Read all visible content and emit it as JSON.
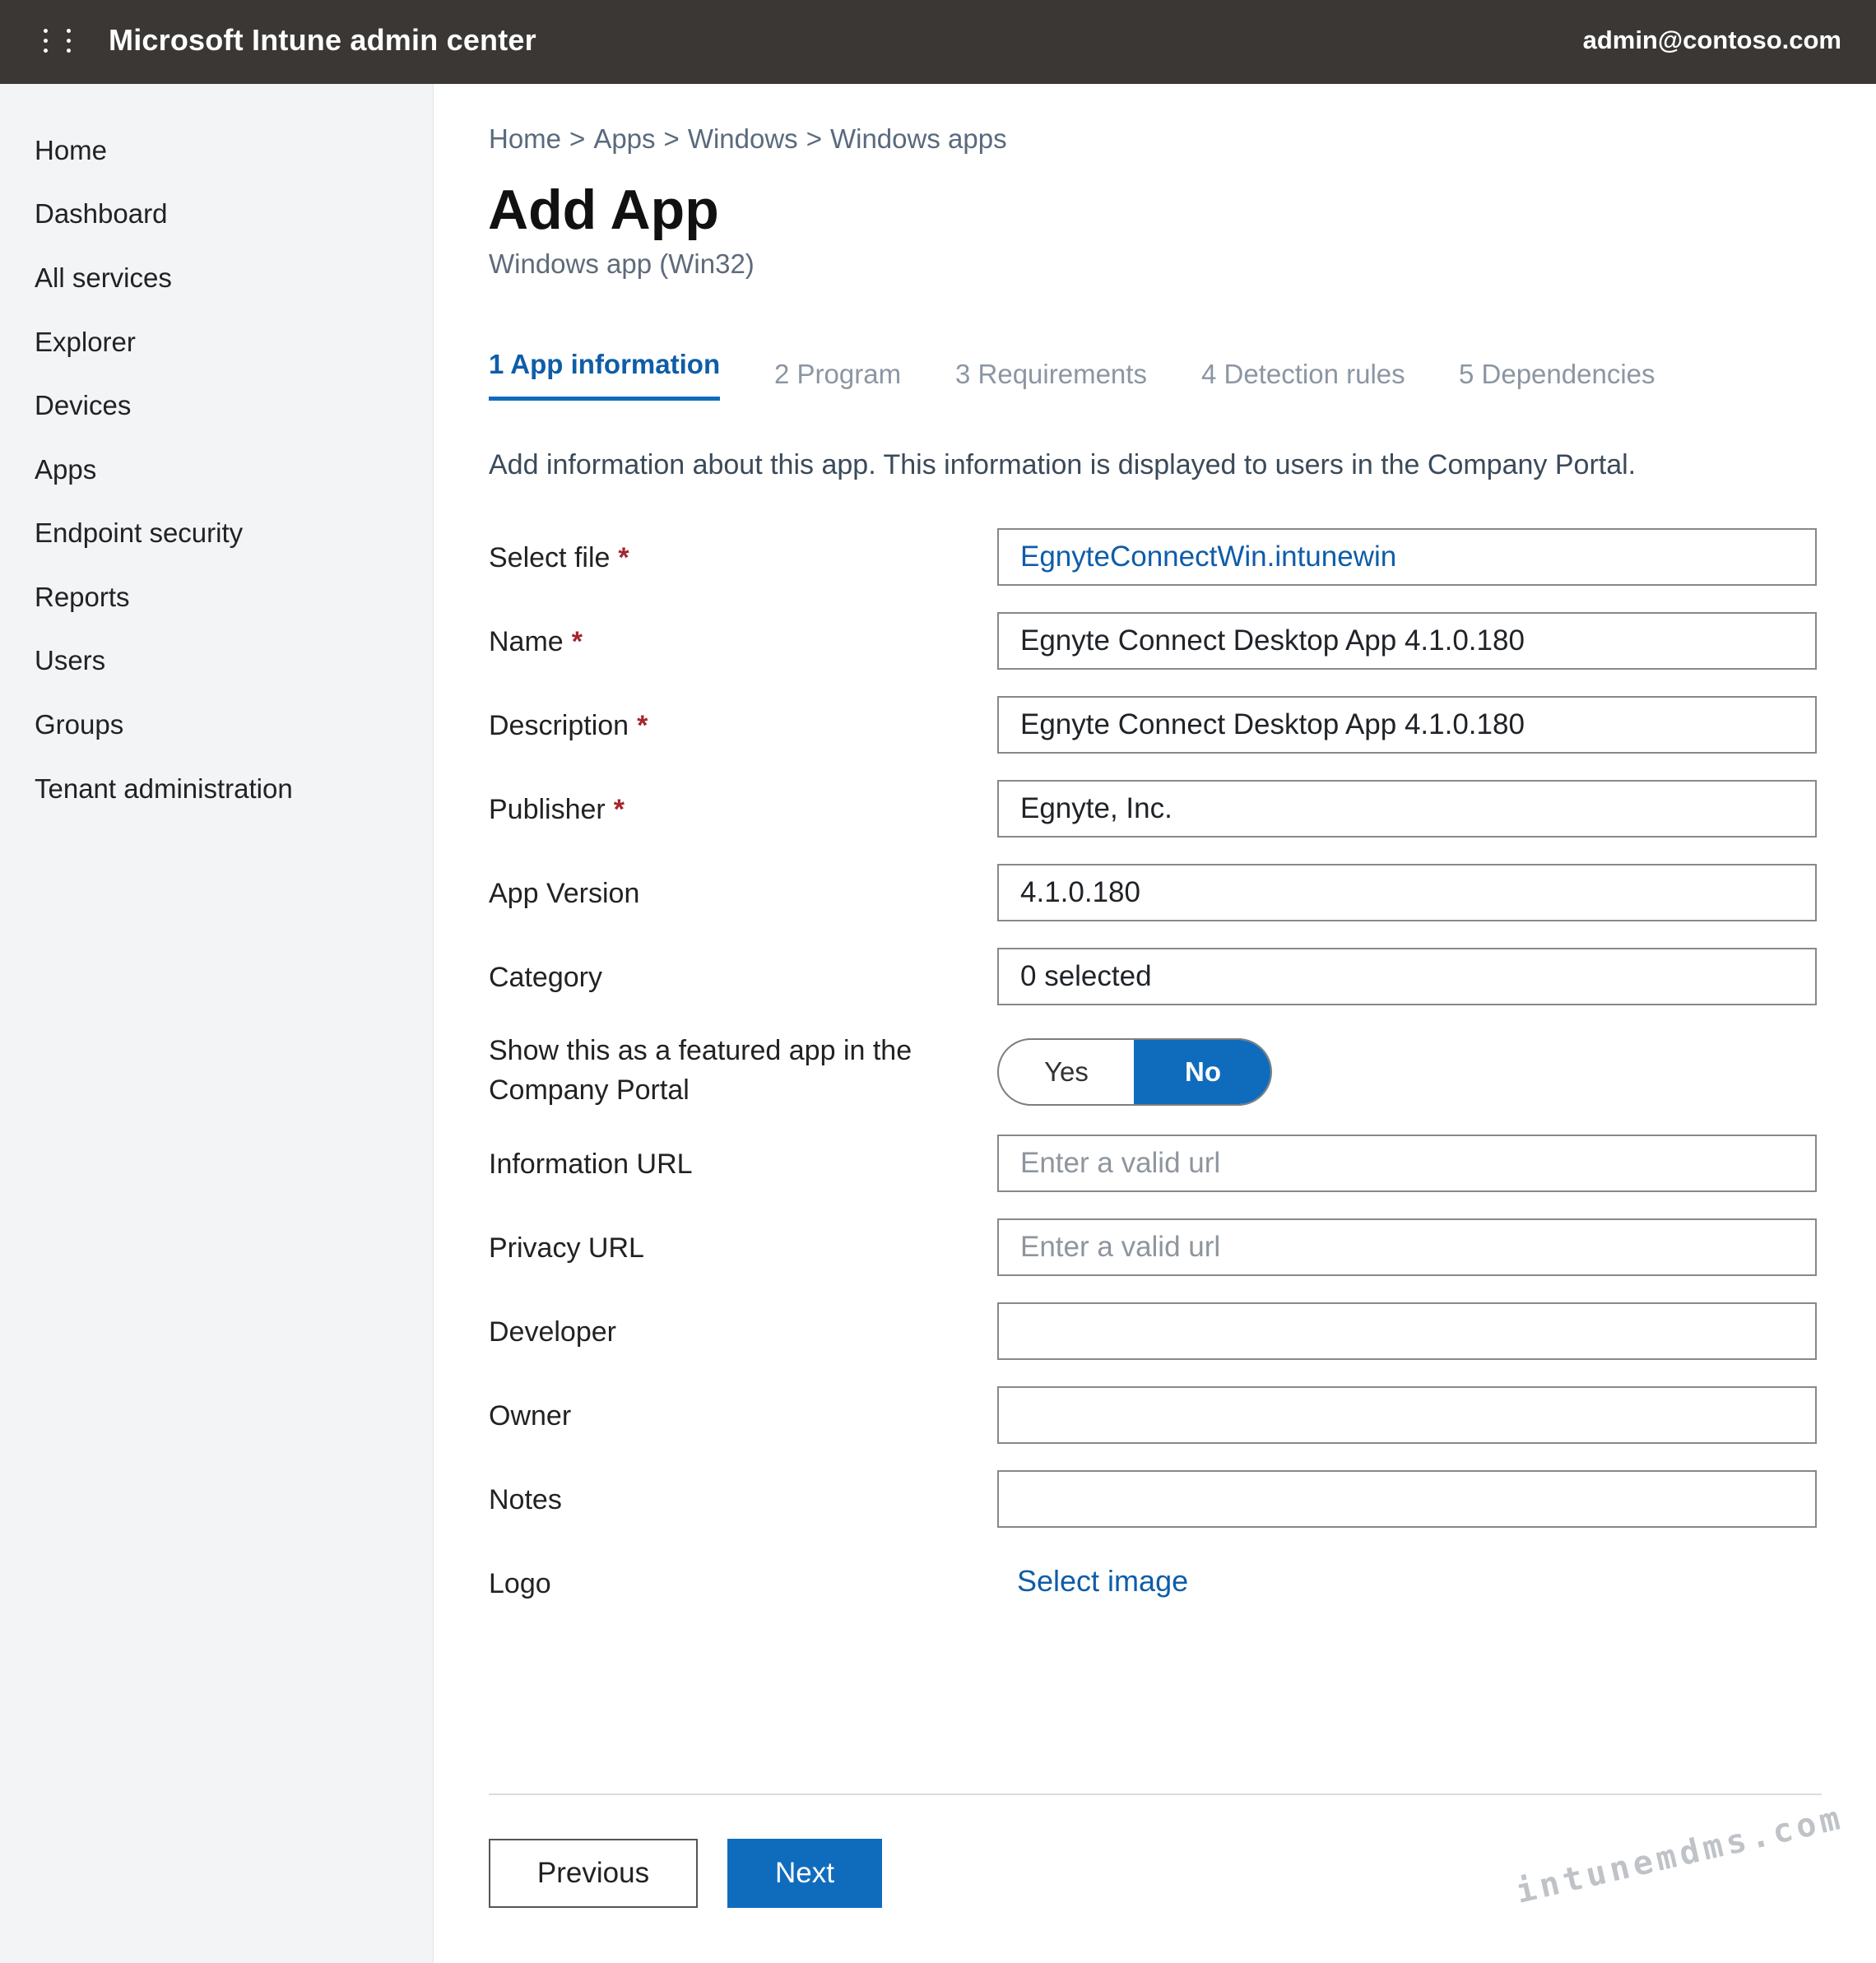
{
  "topbar": {
    "title": "Microsoft Intune admin center",
    "user": "admin@contoso.com",
    "menu_icon": "waffle-menu-icon"
  },
  "sidebar": {
    "items": [
      {
        "label": "Home"
      },
      {
        "label": "Dashboard"
      },
      {
        "label": "All services"
      },
      {
        "label": "Explorer"
      },
      {
        "label": "Devices"
      },
      {
        "label": "Apps"
      },
      {
        "label": "Endpoint security"
      },
      {
        "label": "Reports"
      },
      {
        "label": "Users"
      },
      {
        "label": "Groups"
      },
      {
        "label": "Tenant administration"
      }
    ]
  },
  "breadcrumb": [
    "Home",
    "Apps",
    "Windows",
    "Windows apps"
  ],
  "breadcrumb_separator": ">",
  "page": {
    "title": "Add App",
    "subtitle": "Windows app (Win32)"
  },
  "tabs": [
    {
      "label": "1 App information",
      "active": true
    },
    {
      "label": "2 Program",
      "active": false
    },
    {
      "label": "3 Requirements",
      "active": false
    },
    {
      "label": "4 Detection rules",
      "active": false
    },
    {
      "label": "5 Dependencies",
      "active": false
    }
  ],
  "intro": "Add information about this app. This information is displayed to users in the Company Portal.",
  "required_marker": "*",
  "form": {
    "select_file": {
      "label": "Select file",
      "value": "EgnyteConnectWin.intunewin"
    },
    "name": {
      "label": "Name",
      "value": "Egnyte Connect Desktop App 4.1.0.180"
    },
    "description": {
      "label": "Description",
      "value": "Egnyte Connect Desktop App 4.1.0.180"
    },
    "publisher": {
      "label": "Publisher",
      "value": "Egnyte, Inc."
    },
    "app_version": {
      "label": "App Version",
      "value": "4.1.0.180"
    },
    "category": {
      "label": "Category",
      "value": "0 selected"
    },
    "featured": {
      "label_line1": "Show this as a featured app in the",
      "label_line2": "Company Portal",
      "yes": "Yes",
      "no": "No",
      "selected": "No"
    },
    "information_url": {
      "label": "Information URL",
      "value": "",
      "placeholder": "Enter a valid url"
    },
    "privacy_url": {
      "label": "Privacy URL",
      "value": "",
      "placeholder": "Enter a valid url"
    },
    "developer": {
      "label": "Developer",
      "value": ""
    },
    "owner": {
      "label": "Owner",
      "value": ""
    },
    "notes": {
      "label": "Notes",
      "value": ""
    },
    "logo": {
      "label": "Logo",
      "action": "Select image"
    }
  },
  "footer": {
    "previous": "Previous",
    "next": "Next"
  },
  "watermark": "intunemdms.com",
  "colors": {
    "topbar_bg": "#3b3735",
    "accent": "#0f6cbd",
    "link": "#0f5da8",
    "required": "#a4262c",
    "sidebar_bg": "#f3f4f6"
  }
}
